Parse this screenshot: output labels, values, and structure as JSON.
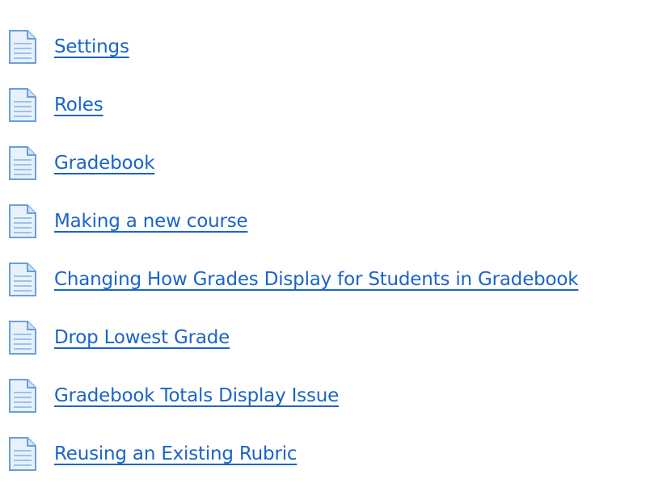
{
  "pages": [
    {
      "label": "Settings",
      "icon": "page-icon"
    },
    {
      "label": "Roles",
      "icon": "page-icon"
    },
    {
      "label": "Gradebook",
      "icon": "page-icon"
    },
    {
      "label": "Making a new course",
      "icon": "page-icon"
    },
    {
      "label": "Changing How Grades Display for Students in Gradebook",
      "icon": "page-icon"
    },
    {
      "label": "Drop Lowest Grade",
      "icon": "page-icon"
    },
    {
      "label": "Gradebook Totals Display Issue",
      "icon": "page-icon"
    },
    {
      "label": "Reusing an Existing Rubric",
      "icon": "page-icon"
    }
  ],
  "colors": {
    "link": "#1a64c8",
    "icon_fill": "#e8f1fb",
    "icon_stroke": "#6a9fd8",
    "icon_lines": "#9dc1ea"
  }
}
